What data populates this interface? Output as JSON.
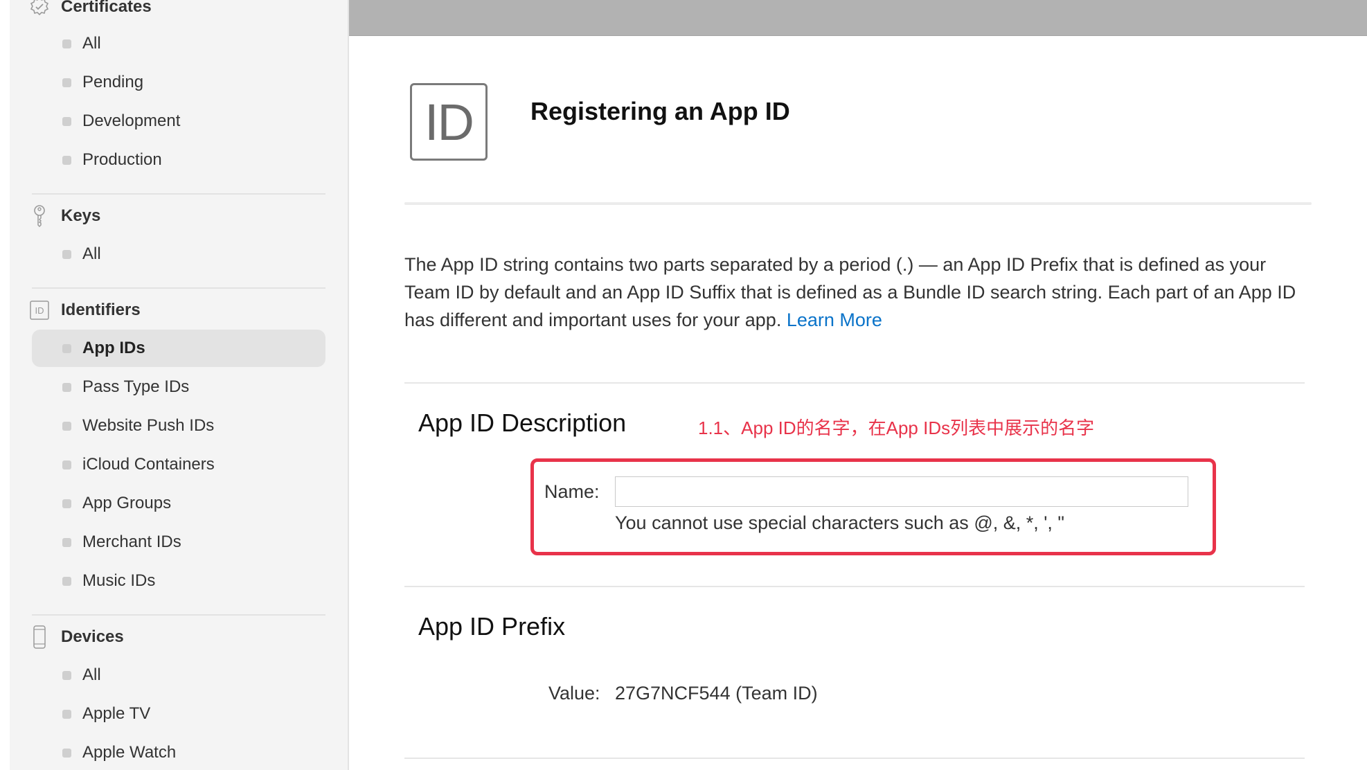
{
  "sidebar": {
    "sections": [
      {
        "title": "Certificates",
        "icon": "certificate-badge-icon",
        "items": [
          {
            "label": "All"
          },
          {
            "label": "Pending"
          },
          {
            "label": "Development"
          },
          {
            "label": "Production"
          }
        ]
      },
      {
        "title": "Keys",
        "icon": "key-icon",
        "items": [
          {
            "label": "All"
          }
        ]
      },
      {
        "title": "Identifiers",
        "icon": "id-icon",
        "id_icon_text": "ID",
        "items": [
          {
            "label": "App IDs",
            "active": true
          },
          {
            "label": "Pass Type IDs"
          },
          {
            "label": "Website Push IDs"
          },
          {
            "label": "iCloud Containers"
          },
          {
            "label": "App Groups"
          },
          {
            "label": "Merchant IDs"
          },
          {
            "label": "Music IDs"
          }
        ]
      },
      {
        "title": "Devices",
        "icon": "device-phone-icon",
        "items": [
          {
            "label": "All"
          },
          {
            "label": "Apple TV"
          },
          {
            "label": "Apple Watch"
          }
        ]
      }
    ]
  },
  "main": {
    "badge_text": "ID",
    "title": "Registering an App ID",
    "intro_text": "The App ID string contains two parts separated by a period (.) — an App ID Prefix that is defined as your Team ID by default and an App ID Suffix that is defined as a Bundle ID search string. Each part of an App ID has different and important uses for your app.",
    "learn_more": "Learn More",
    "description_section": {
      "title": "App ID Description",
      "annotation": "1.1、App ID的名字，在App IDs列表中展示的名字",
      "name_label": "Name:",
      "name_value": "",
      "name_placeholder": "",
      "hint": "You cannot use special characters such as @, &, *, ', \""
    },
    "prefix_section": {
      "title": "App ID Prefix",
      "value_label": "Value:",
      "value": "27G7NCF544 (Team ID)"
    }
  },
  "colors": {
    "accent_link": "#0a73c9",
    "annotation_red": "#e8334a",
    "topbar_gray": "#b2b2b2"
  }
}
